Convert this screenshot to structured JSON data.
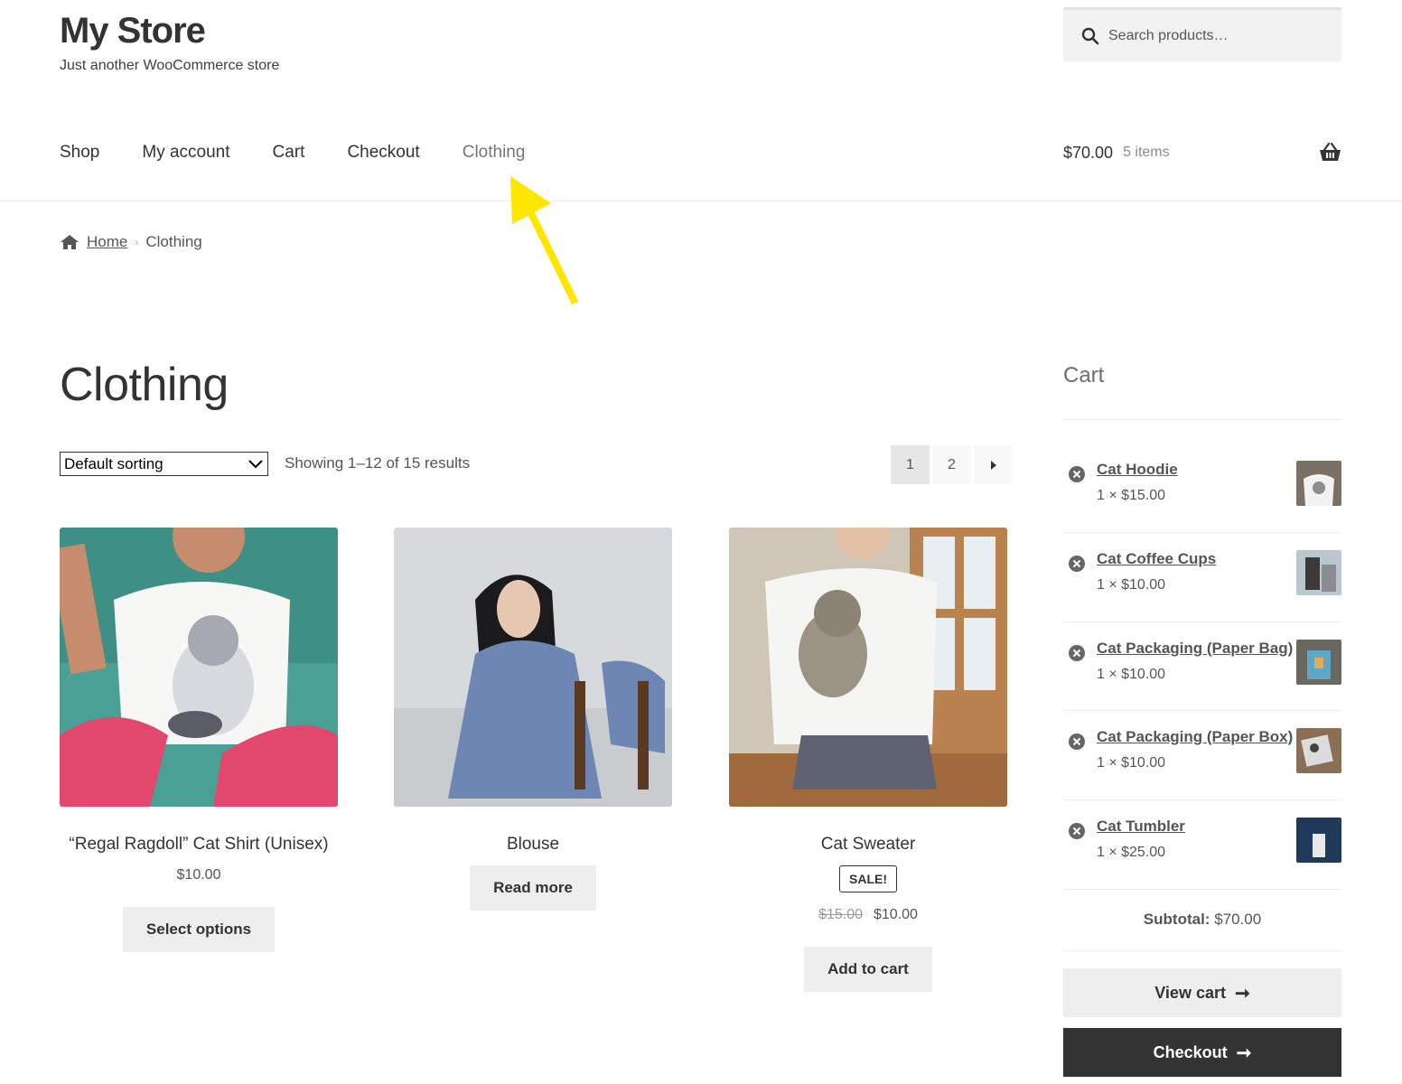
{
  "site": {
    "title": "My Store",
    "tagline": "Just another WooCommerce store"
  },
  "search": {
    "placeholder": "Search products…"
  },
  "nav": {
    "items": [
      "Shop",
      "My account",
      "Cart",
      "Checkout",
      "Clothing"
    ],
    "current": "Clothing"
  },
  "header_cart": {
    "amount": "$70.00",
    "count": "5 items"
  },
  "breadcrumb": {
    "home": "Home",
    "current": "Clothing"
  },
  "page": {
    "title": "Clothing"
  },
  "toolbar": {
    "sort_value": "Default sorting",
    "result_count": "Showing 1–12 of 15 results"
  },
  "pagination": {
    "pages": [
      "1",
      "2"
    ],
    "current": "1"
  },
  "products": [
    {
      "name": "“Regal Ragdoll” Cat Shirt (Unisex)",
      "price": "$10.00",
      "button": "Select options"
    },
    {
      "name": "Blouse",
      "button": "Read more"
    },
    {
      "name": "Cat Sweater",
      "badge": "SALE!",
      "old_price": "$15.00",
      "price": "$10.00",
      "button": "Add to cart"
    }
  ],
  "cart_widget": {
    "title": "Cart",
    "items": [
      {
        "name": "Cat Hoodie",
        "qty": "1 × $15.00"
      },
      {
        "name": "Cat Coffee Cups",
        "qty": "1 × $10.00"
      },
      {
        "name": "Cat Packaging (Paper Bag)",
        "qty": "1 × $10.00"
      },
      {
        "name": "Cat Packaging (Paper Box)",
        "qty": "1 × $10.00"
      },
      {
        "name": "Cat Tumbler",
        "qty": "1 × $25.00"
      }
    ],
    "subtotal_label": "Subtotal:",
    "subtotal_value": "$70.00",
    "view_cart": "View cart",
    "checkout": "Checkout"
  },
  "colors": {
    "text": "#333333",
    "muted": "#555555",
    "button_bg": "#eeeeee",
    "dark_button": "#333333",
    "annotation_arrow": "#ffe600"
  }
}
